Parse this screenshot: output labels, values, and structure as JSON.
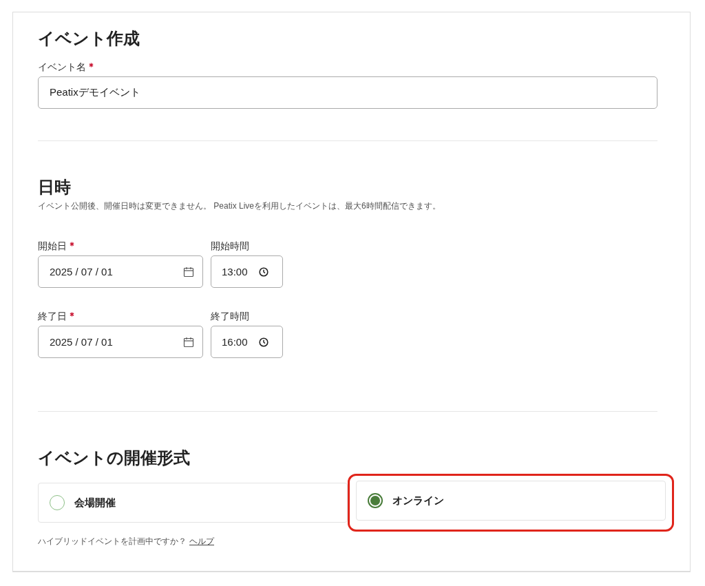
{
  "title": "イベント作成",
  "event_name": {
    "label": "イベント名",
    "required": true,
    "value": "Peatixデモイベント"
  },
  "datetime": {
    "heading": "日時",
    "note": "イベント公開後、開催日時は変更できません。 Peatix Liveを利用したイベントは、最大6時間配信できます。",
    "rows": [
      {
        "date_label": "開始日",
        "date_required": true,
        "date": "2025 / 07 / 01",
        "time_label": "開始時間",
        "time": "13:00"
      },
      {
        "date_label": "終了日",
        "date_required": true,
        "date": "2025 / 07 / 01",
        "time_label": "終了時間",
        "time": "16:00"
      }
    ]
  },
  "format": {
    "heading": "イベントの開催形式",
    "options": [
      {
        "label": "会場開催",
        "selected": false,
        "highlighted": false
      },
      {
        "label": "オンライン",
        "selected": true,
        "highlighted": true
      }
    ],
    "hint": "ハイブリッドイベントを計画中ですか？",
    "help_link": "ヘルプ"
  }
}
